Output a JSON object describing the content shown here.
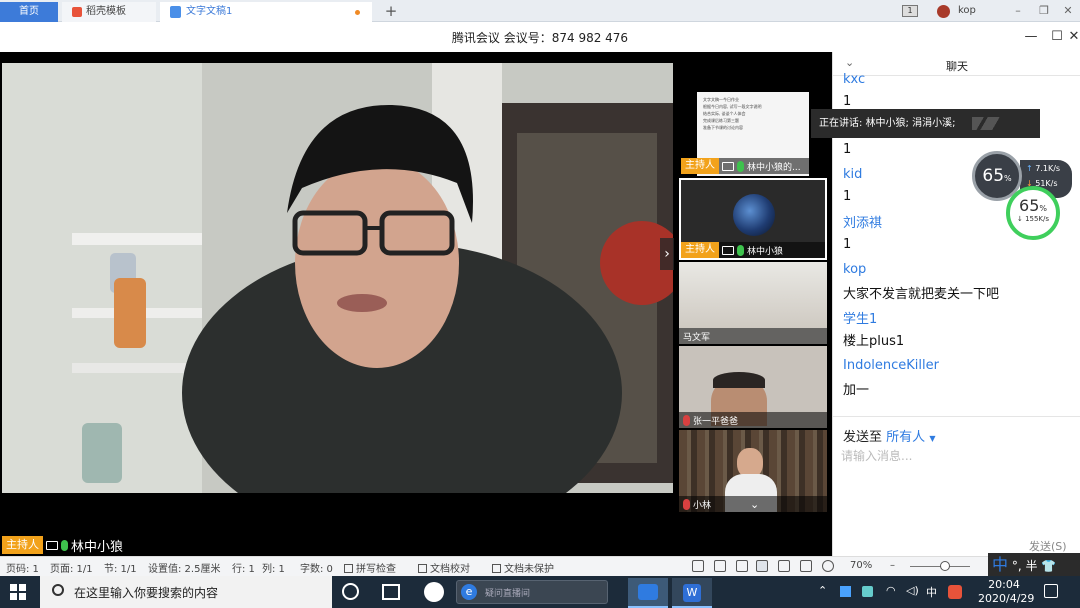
{
  "tabbar": {
    "tabs": [
      {
        "label": "首页"
      },
      {
        "label": "稻壳模板"
      },
      {
        "label": "文字文稿1"
      }
    ],
    "add_label": "+",
    "window_count": "1",
    "user": "kop"
  },
  "meeting": {
    "title": "腾讯会议 会议号：874 982 476",
    "main_speaker": {
      "role": "主持人",
      "name": "林中小狼"
    },
    "thumbnails": [
      {
        "role": "主持人",
        "name": "林中小狼的..."
      },
      {
        "role": "主持人",
        "name": "林中小狼"
      },
      {
        "role": "",
        "name": "马文军"
      },
      {
        "role": "",
        "name": "张一平爸爸"
      },
      {
        "role": "",
        "name": "小林"
      }
    ],
    "speaking_tip": "正在讲话: 林中小狼; 涓涓小溪;",
    "doc_preview_lines": [
      "文字文稿一今日作业",
      "根据今日内容, 试写一段文字说明",
      "结合实际, 谈谈个人体会",
      "完成课后练习第三题",
      "准备下节课的讨论内容"
    ]
  },
  "chat": {
    "title": "聊天",
    "messages": [
      {
        "sender": "kxc",
        "text": "1"
      },
      {
        "sender": "",
        "text": "1"
      },
      {
        "sender": "kid",
        "text": "1"
      },
      {
        "sender": "刘添祺",
        "text": "1"
      },
      {
        "sender": "kop",
        "text": "大家不发言就把麦关一下吧"
      },
      {
        "sender": "学生1",
        "text": "楼上plus1"
      },
      {
        "sender": "IndolenceKiller",
        "text": "加一"
      }
    ],
    "send_to_label": "发送至",
    "send_to_target": "所有人",
    "input_placeholder": "请输入消息...",
    "send_button": "发送(S)"
  },
  "network": {
    "gauge_a_pct": "65",
    "gauge_a_unit": "%",
    "upload": "7.1K/s",
    "download_small": "51K/s",
    "gauge_b_pct": "65",
    "gauge_b_unit": "%",
    "gauge_b_speed": "155K/s"
  },
  "statusbar": {
    "page_num": "页码: 1",
    "pages": "页面: 1/1",
    "section": "节: 1/1",
    "setting": "设置值: 2.5厘米",
    "row": "行: 1",
    "col": "列: 1",
    "words": "字数: 0",
    "spell": "拼写检查",
    "proof": "文档校对",
    "protect": "文档未保护",
    "zoom": "70%"
  },
  "ime": {
    "mode": "中",
    "extra": "°, 半"
  },
  "taskbar": {
    "search_placeholder": "在这里输入你要搜索的内容",
    "browser_search_placeholder": "疑问直播间",
    "tray_lang": "中",
    "time": "20:04",
    "date": "2020/4/29"
  },
  "colors": {
    "accent_blue": "#2f7be0",
    "host_badge": "#f2a21b",
    "mic_on": "#3ec24d",
    "mic_off": "#d84040"
  }
}
